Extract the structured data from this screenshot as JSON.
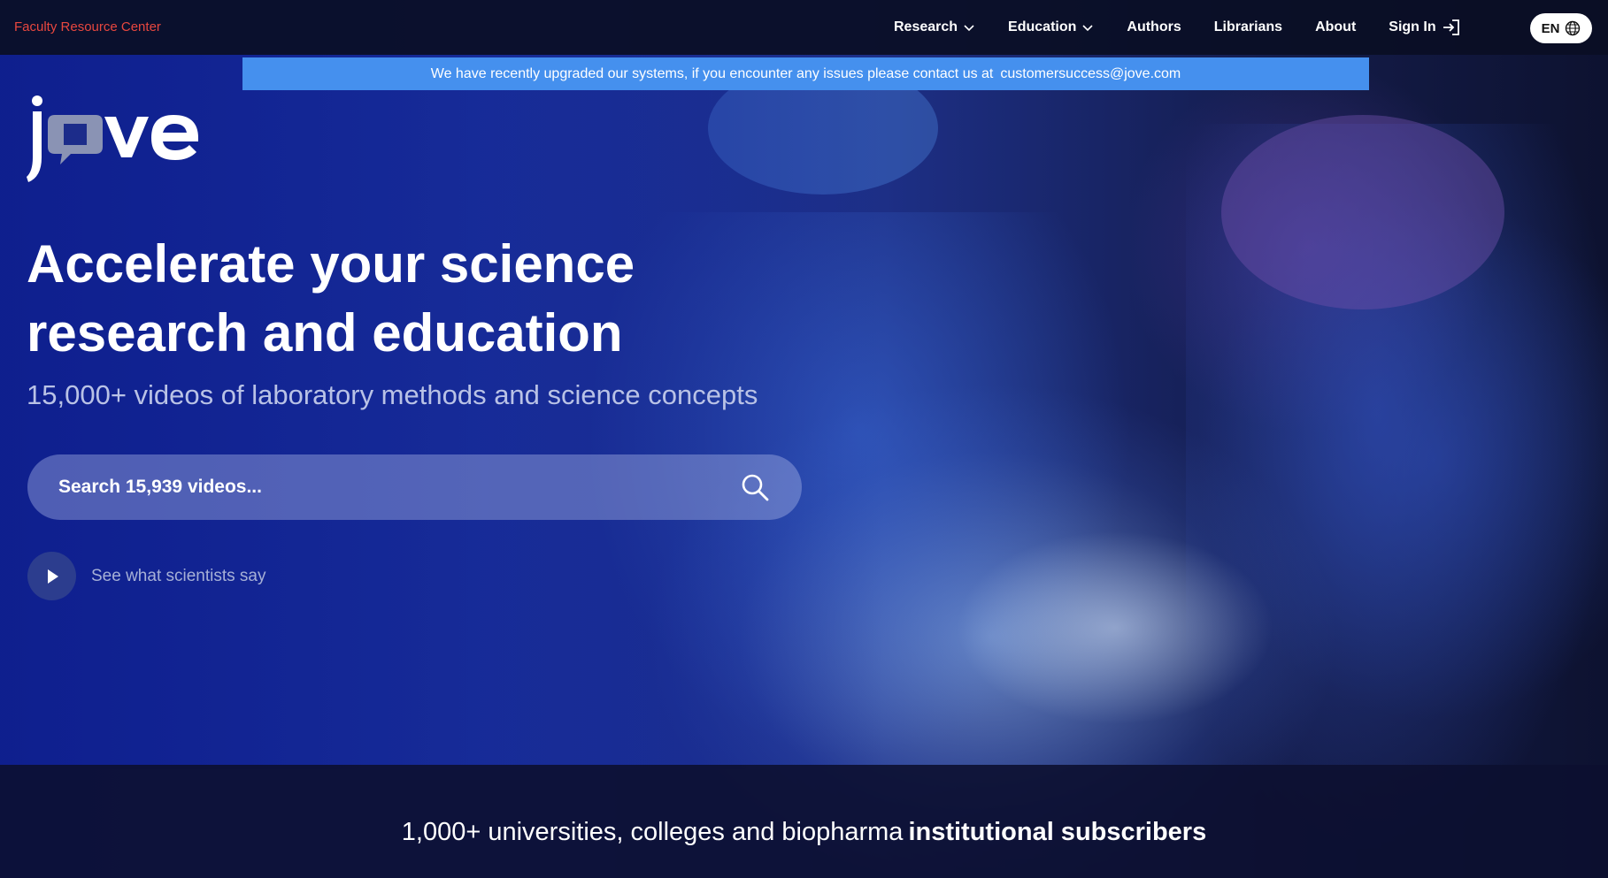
{
  "topbar": {
    "faculty_link": "Faculty Resource Center",
    "nav": [
      {
        "label": "Research",
        "has_dropdown": true
      },
      {
        "label": "Education",
        "has_dropdown": true
      },
      {
        "label": "Authors",
        "has_dropdown": false
      },
      {
        "label": "Librarians",
        "has_dropdown": false
      },
      {
        "label": "About",
        "has_dropdown": false
      }
    ],
    "sign_in": "Sign In",
    "language": "EN"
  },
  "notice": {
    "text": "We have recently upgraded our systems, if you encounter any issues please contact us at",
    "email": "customersuccess@jove.com"
  },
  "logo": {
    "text": "jove"
  },
  "hero": {
    "title_line1": "Accelerate your science",
    "title_line2": "research and education",
    "subtitle": "15,000+ videos of laboratory methods and science concepts",
    "search_placeholder": "Search 15,939 videos...",
    "play_label": "See what scientists say"
  },
  "band": {
    "text": "1,000+ universities, colleges and biopharma",
    "strong": "institutional subscribers"
  },
  "colors": {
    "accent_red": "#e8473f",
    "notice_blue": "#4590ee",
    "topbar_bg": "#0a0e24"
  }
}
